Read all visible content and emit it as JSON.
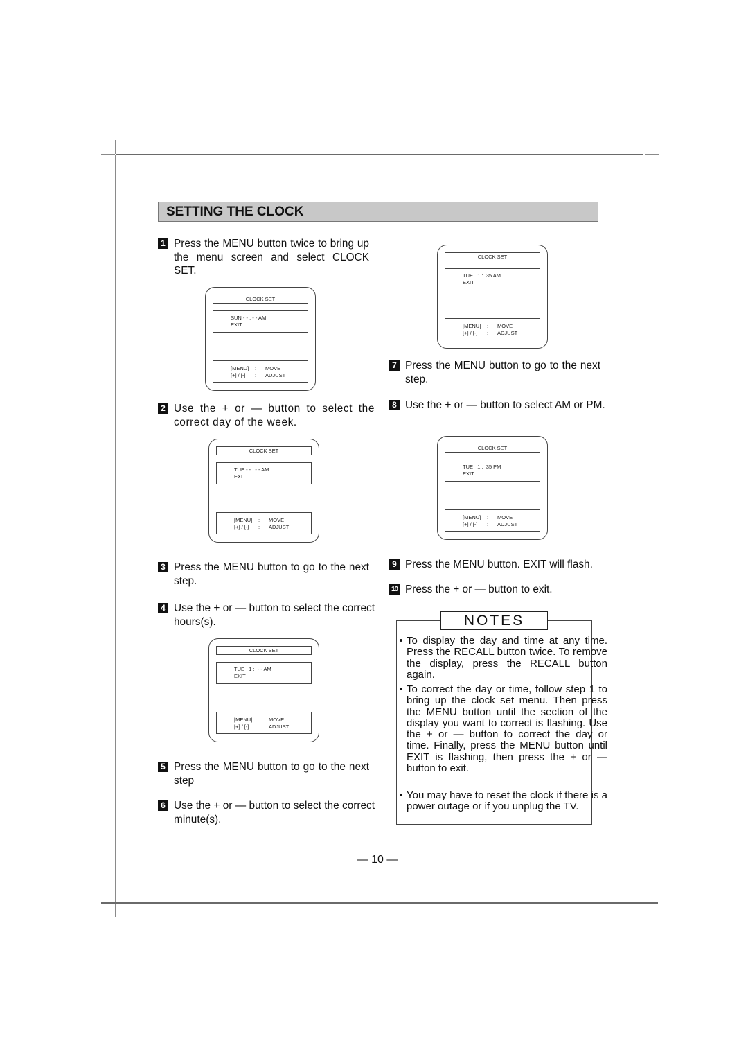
{
  "section_title": "SETTING THE CLOCK",
  "steps": [
    {
      "num": "1",
      "text": "Press the MENU button twice to bring up the menu screen and select CLOCK SET."
    },
    {
      "num": "2",
      "text": "Use the + or — button to select the correct day of the week."
    },
    {
      "num": "3",
      "text": "Press the MENU button to go to the next step."
    },
    {
      "num": "4",
      "text": "Use the + or — button to select the correct hours(s)."
    },
    {
      "num": "5",
      "text": "Press the MENU button to go to the next step"
    },
    {
      "num": "6",
      "text": "Use the + or — button to select the correct minute(s)."
    },
    {
      "num": "7",
      "text": "Press the MENU button to go to the next step."
    },
    {
      "num": "8",
      "text": "Use the + or — button to select AM or PM."
    },
    {
      "num": "9",
      "text": "Press the MENU button. EXIT will flash."
    },
    {
      "num": "10",
      "text": "Press the + or — button to exit."
    }
  ],
  "screens": [
    {
      "header": "CLOCK SET",
      "line1": "SUN - - : - - AM",
      "line2": "EXIT",
      "key1": "[MENU]",
      "sep1": ":",
      "val1": "MOVE",
      "key2": "[+] / [-]",
      "sep2": ":",
      "val2": "ADJUST"
    },
    {
      "header": "CLOCK SET",
      "line1": "TUE - - : - - AM",
      "line2": "EXIT",
      "key1": "[MENU]",
      "sep1": ":",
      "val1": "MOVE",
      "key2": "[+] / [-]",
      "sep2": ":",
      "val2": "ADJUST"
    },
    {
      "header": "CLOCK SET",
      "line1": "TUE   1 :  - - AM",
      "line2": "EXIT",
      "key1": "[MENU]",
      "sep1": ":",
      "val1": "MOVE",
      "key2": "[+] / [-]",
      "sep2": ":",
      "val2": "ADJUST"
    },
    {
      "header": "CLOCK SET",
      "line1": "TUE   1 :  35 AM",
      "line2": "EXIT",
      "key1": "[MENU]",
      "sep1": ":",
      "val1": "MOVE",
      "key2": "[+] / [-]",
      "sep2": ":",
      "val2": "ADJUST"
    },
    {
      "header": "CLOCK SET",
      "line1": "TUE   1 :  35 PM",
      "line2": "EXIT",
      "key1": "[MENU]",
      "sep1": ":",
      "val1": "MOVE",
      "key2": "[+] / [-]",
      "sep2": ":",
      "val2": "ADJUST"
    }
  ],
  "notes": {
    "title": "NOTES",
    "bullet": "•",
    "items": [
      "To display the day and time at any time. Press the RECALL button twice. To remove the display, press the RECALL button again.",
      "To correct the day or time, follow step 1 to bring up the clock set menu. Then press the MENU button until the section of the display you want to correct is flashing. Use the + or — button to correct the day or time. Finally, press the MENU button until EXIT is flashing, then press the + or — button to exit.",
      "You may have to reset the clock if there is a power outage or if you unplug the TV."
    ]
  },
  "page_number": "— 10 —"
}
